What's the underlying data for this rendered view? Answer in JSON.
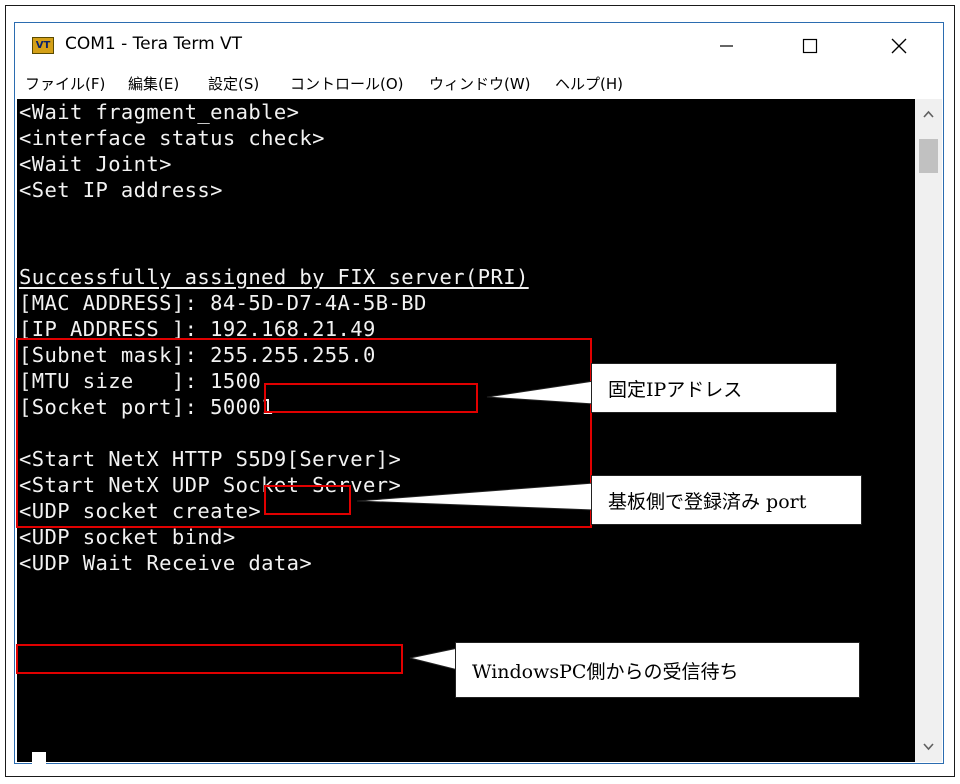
{
  "window": {
    "icon_label": "VT",
    "title": "COM1 - Tera Term VT"
  },
  "menu": [
    {
      "label": "ファイル(F)"
    },
    {
      "label": "編集(E)"
    },
    {
      "label": "設定(S)"
    },
    {
      "label": "コントロール(O)"
    },
    {
      "label": "ウィンドウ(W)"
    },
    {
      "label": "ヘルプ(H)"
    }
  ],
  "terminal_lines": [
    "<Wait fragment_enable>",
    "<interface status check>",
    "<Wait Joint>",
    "<Set IP address>",
    "",
    "Successfully assigned by FIX server(PRI)",
    "[MAC ADDRESS]: 84-5D-D7-4A-5B-BD",
    "[IP ADDRESS ]: 192.168.21.49",
    "[Subnet mask]: 255.255.255.0",
    "[MTU size   ]: 1500",
    "[Socket port]: 50001",
    "",
    "<Start NetX HTTP S5D9[Server]>",
    "<Start NetX UDP Socket Server>",
    "<UDP socket create>",
    "<UDP socket bind>",
    "<UDP Wait Receive data>"
  ],
  "callouts": {
    "fixed_ip": "固定IPアドレス",
    "registered_port": "基板側で登録済み port",
    "waiting_receive": "WindowsPC側からの受信待ち"
  },
  "colors": {
    "terminal_bg": "#000000",
    "terminal_fg": "#f2f2f2",
    "highlight_box": "#e10000",
    "window_border": "#2b6cb0"
  }
}
